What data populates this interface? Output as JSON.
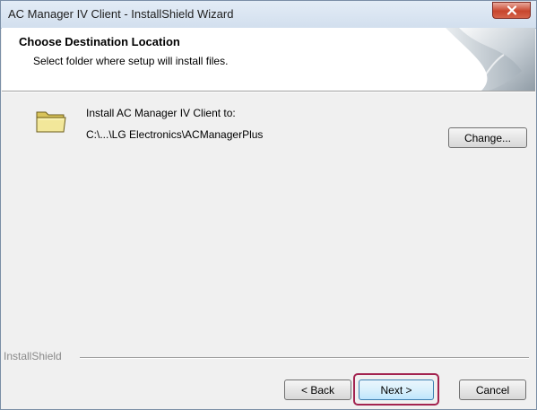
{
  "window": {
    "title": "AC Manager IV Client - InstallShield Wizard"
  },
  "header": {
    "title": "Choose Destination Location",
    "subtitle": "Select folder where setup will install files."
  },
  "destination": {
    "label": "Install AC Manager IV Client to:",
    "path": "C:\\...\\LG Electronics\\ACManagerPlus",
    "change_label": "Change..."
  },
  "footer": {
    "brand": "InstallShield",
    "back_label": "< Back",
    "next_label": "Next >",
    "cancel_label": "Cancel"
  },
  "icons": {
    "close": "close-icon",
    "folder": "folder-icon",
    "header_graphic": "page-curl-graphic"
  },
  "colors": {
    "focus_highlight": "#a3234f",
    "close_button": "#c7452d"
  }
}
